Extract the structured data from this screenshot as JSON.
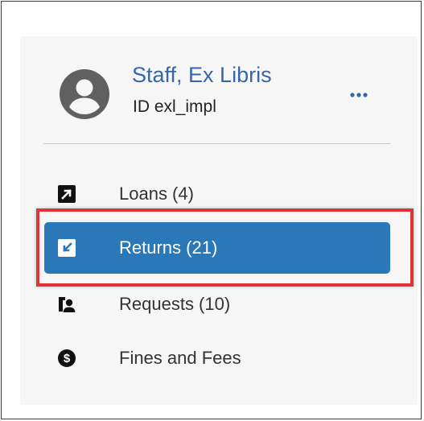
{
  "user": {
    "name": "Staff, Ex Libris",
    "id_prefix": "ID",
    "id_value": "exl_impl",
    "more_label": "…"
  },
  "nav": {
    "items": [
      {
        "label": "Loans (4)",
        "icon": "loan-arrow-icon",
        "active": false
      },
      {
        "label": "Returns (21)",
        "icon": "return-check-icon",
        "active": true
      },
      {
        "label": "Requests (10)",
        "icon": "request-person-icon",
        "active": false
      },
      {
        "label": "Fines and Fees",
        "icon": "dollar-coin-icon",
        "active": false
      }
    ]
  },
  "colors": {
    "accent": "#2a78b8",
    "name_link": "#3a64a8",
    "highlight": "#e0343b",
    "panel_bg": "#f6f6f6"
  }
}
